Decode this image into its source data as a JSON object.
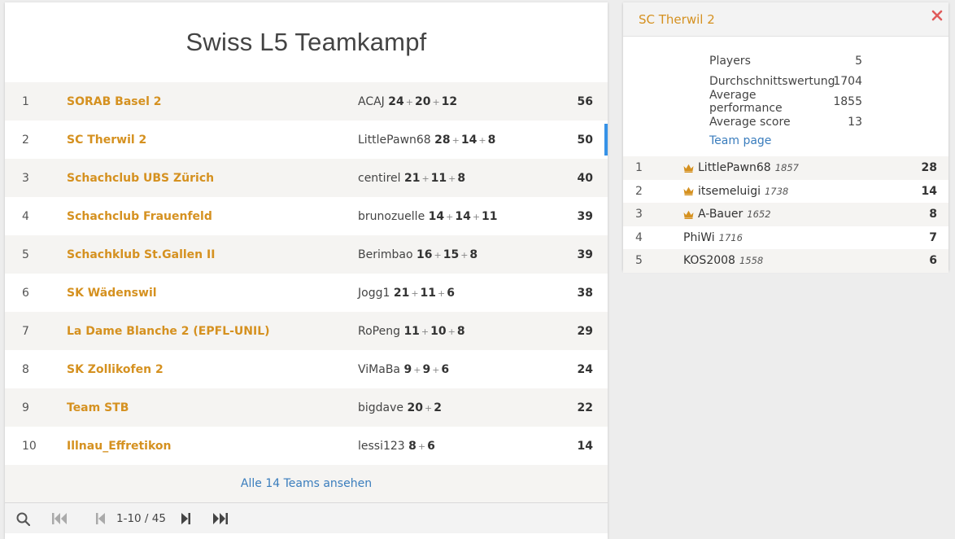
{
  "main": {
    "title": "Swiss L5 Teamkampf",
    "rows": [
      {
        "rank": "1",
        "team": "SORAB Basel 2",
        "player": "ACAJ",
        "points": [
          "24",
          "20",
          "12"
        ],
        "score": "56"
      },
      {
        "rank": "2",
        "team": "SC Therwil 2",
        "player": "LittlePawn68",
        "points": [
          "28",
          "14",
          "8"
        ],
        "score": "50"
      },
      {
        "rank": "3",
        "team": "Schachclub UBS Zürich",
        "player": "centirel",
        "points": [
          "21",
          "11",
          "8"
        ],
        "score": "40"
      },
      {
        "rank": "4",
        "team": "Schachclub Frauenfeld",
        "player": "brunozuelle",
        "points": [
          "14",
          "14",
          "11"
        ],
        "score": "39"
      },
      {
        "rank": "5",
        "team": "Schachklub St.Gallen II",
        "player": "Berimbao",
        "points": [
          "16",
          "15",
          "8"
        ],
        "score": "39"
      },
      {
        "rank": "6",
        "team": "SK Wädenswil",
        "player": "Jogg1",
        "points": [
          "21",
          "11",
          "6"
        ],
        "score": "38"
      },
      {
        "rank": "7",
        "team": "La Dame Blanche 2 (EPFL-UNIL)",
        "player": "RoPeng",
        "points": [
          "11",
          "10",
          "8"
        ],
        "score": "29"
      },
      {
        "rank": "8",
        "team": "SK Zollikofen 2",
        "player": "ViMaBa",
        "points": [
          "9",
          "9",
          "6"
        ],
        "score": "24"
      },
      {
        "rank": "9",
        "team": "Team STB",
        "player": "bigdave",
        "points": [
          "20",
          "2"
        ],
        "score": "22"
      },
      {
        "rank": "10",
        "team": "Illnau_Effretikon",
        "player": "lessi123",
        "points": [
          "8",
          "6"
        ],
        "score": "14"
      }
    ],
    "all_teams_link": "Alle 14 Teams ansehen",
    "pager": {
      "info": "1-10 / 45"
    },
    "plus_sign": "+"
  },
  "side": {
    "title": "SC Therwil 2",
    "stats": [
      {
        "label": "Players",
        "value": "5"
      },
      {
        "label": "Durchschnittswertung",
        "value": "1704"
      },
      {
        "label": "Average performance",
        "value": "1855"
      },
      {
        "label": "Average score",
        "value": "13"
      }
    ],
    "team_page_link": "Team page",
    "players": [
      {
        "rank": "1",
        "leader": true,
        "name": "LittlePawn68",
        "rating": "1857",
        "score": "28"
      },
      {
        "rank": "2",
        "leader": true,
        "name": "itsemeluigi",
        "rating": "1738",
        "score": "14"
      },
      {
        "rank": "3",
        "leader": true,
        "name": "A-Bauer",
        "rating": "1652",
        "score": "8"
      },
      {
        "rank": "4",
        "leader": false,
        "name": "PhiWi",
        "rating": "1716",
        "score": "7"
      },
      {
        "rank": "5",
        "leader": false,
        "name": "KOS2008",
        "rating": "1558",
        "score": "6"
      }
    ]
  },
  "colors": {
    "accent": "#d59120",
    "link": "#3a7dbd",
    "active_marker": "#3692e7",
    "close": "#e05a5a"
  }
}
